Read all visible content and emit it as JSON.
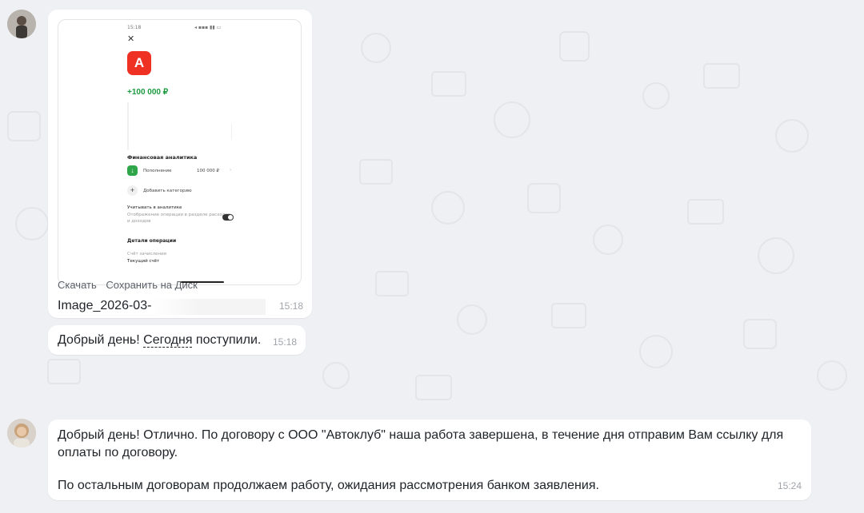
{
  "chat": {
    "messages": [
      {
        "type": "image",
        "actions": [
          "Скачать",
          "Сохранить на Диск"
        ],
        "filename": "Image_2026-03-",
        "time": "15:18",
        "preview": {
          "status_time": "15:18",
          "amount": "+100 000 ₽",
          "section_analytics": "Финансовая аналитика",
          "category": "Пополнение",
          "category_amount": "100 000 ₽",
          "add_category": "Добавить категорию",
          "include_title": "Учитывать в аналитике",
          "include_desc_1": "Отображение операции в разделе расходов",
          "include_desc_2": "и доходов",
          "details_title": "Детали операции",
          "account_label": "Счёт зачисления",
          "account_value": "Текущий счёт"
        }
      },
      {
        "type": "text",
        "text_before": "Добрый день! ",
        "text_link": "Сегодня",
        "text_after": " поступили.",
        "time": "15:18"
      },
      {
        "type": "text",
        "line1": "Добрый день! Отлично. По договору с ООО \"Автоклуб\" наша работа завершена, в течение дня отправим Вам ссылку для",
        "line2": "оплаты по договору.",
        "line3": "По остальным договорам продолжаем работу, ожидания рассмотрения банком заявления.",
        "time": "15:24"
      }
    ]
  },
  "colors": {
    "background": "#eef0f3",
    "bubble": "#ffffff",
    "bank_red": "#ef3124",
    "amount_green": "#1b9a3f"
  }
}
